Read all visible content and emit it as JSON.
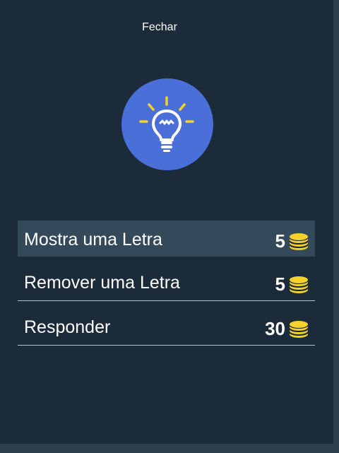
{
  "dialog": {
    "close_label": "Fechar",
    "icon": "lightbulb-icon",
    "accent_color": "#4a6fd8",
    "coin_color": "#f5d22a"
  },
  "options": [
    {
      "label": "Mostra uma Letra",
      "cost": "5",
      "selected": true
    },
    {
      "label": "Remover uma Letra",
      "cost": "5",
      "selected": false
    },
    {
      "label": "Responder",
      "cost": "30",
      "selected": false
    }
  ]
}
